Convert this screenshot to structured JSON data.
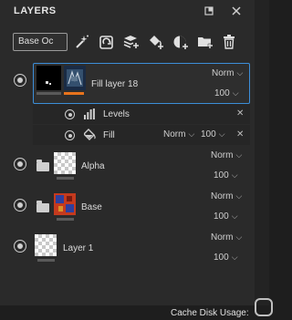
{
  "panel": {
    "title": "LAYERS",
    "header_icons": [
      "expand-icon",
      "close-icon"
    ]
  },
  "toolbar": {
    "blend_mode": "Base Oc",
    "buttons": [
      "magic-wand-icon",
      "rotate-icon",
      "add-layer-stack-icon",
      "fill-bucket-add-icon",
      "mask-icon",
      "new-folder-icon",
      "trash-icon"
    ]
  },
  "layers": [
    {
      "name": "Fill layer 18",
      "blend": "Norm",
      "opacity": "100"
    },
    {
      "name": "Alpha",
      "blend": "Norm",
      "opacity": "100"
    },
    {
      "name": "Base",
      "blend": "Norm",
      "opacity": "100"
    },
    {
      "name": "Layer 1",
      "blend": "Norm",
      "opacity": "100"
    }
  ],
  "effects": [
    {
      "name": "Levels"
    },
    {
      "name": "Fill",
      "blend": "Norm",
      "opacity": "100"
    }
  ],
  "footer": {
    "cache_label": "Cache Disk Usage:"
  },
  "colors": {
    "selection_border": "#3c8ed8",
    "accent_orange": "#e8731c"
  }
}
